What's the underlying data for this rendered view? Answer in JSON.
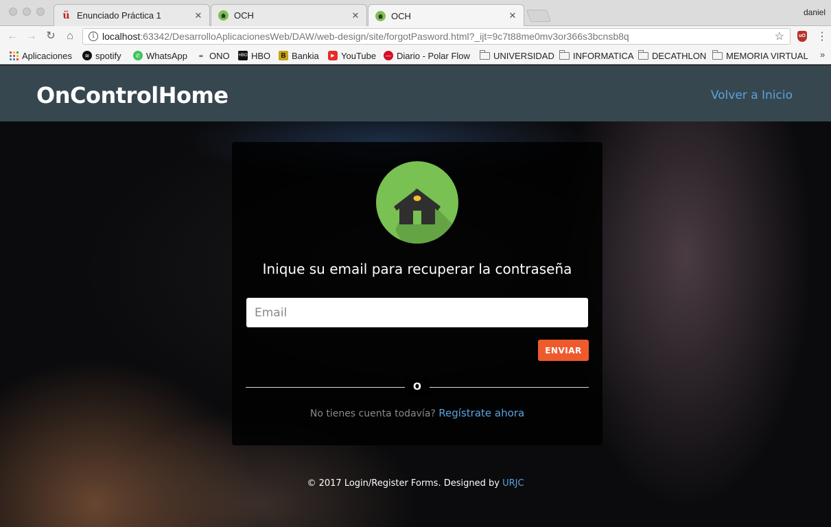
{
  "browser": {
    "tabs": [
      {
        "title": "Enunciado Práctica 1",
        "icon": "urjc-icon"
      },
      {
        "title": "OCH",
        "icon": "house-icon"
      },
      {
        "title": "OCH",
        "icon": "house-icon"
      }
    ],
    "user": "daniel",
    "url_host": "localhost",
    "url_path": ":63342/DesarrolloAplicacionesWeb/DAW/web-design/site/forgotPasword.html?_ijt=9c7t88me0mv3or366s3bcnsb8q",
    "ext_badge": "uO",
    "bookmarks": [
      {
        "label": "Aplicaciones",
        "icon": "apps-grid-icon"
      },
      {
        "label": "spotify",
        "icon": "spotify-icon"
      },
      {
        "label": "WhatsApp",
        "icon": "whatsapp-icon"
      },
      {
        "label": "ONO",
        "icon": "ono-icon"
      },
      {
        "label": "HBO",
        "icon": "hbo-icon"
      },
      {
        "label": "Bankia",
        "icon": "bankia-icon"
      },
      {
        "label": "YouTube",
        "icon": "youtube-icon"
      },
      {
        "label": "Diario - Polar Flow",
        "icon": "polar-icon"
      },
      {
        "label": "UNIVERSIDAD",
        "icon": "folder-icon"
      },
      {
        "label": "INFORMATICA",
        "icon": "folder-icon"
      },
      {
        "label": "DECATHLON",
        "icon": "folder-icon"
      },
      {
        "label": "MEMORIA VIRTUAL",
        "icon": "folder-icon"
      }
    ]
  },
  "header": {
    "brand": "OnControlHome",
    "back_link": "Volver a Inicio"
  },
  "form": {
    "prompt": "Inique su email para recuperar la contraseña",
    "email_placeholder": "Email",
    "send_label": "ENVIAR",
    "or_label": "O",
    "no_account": "No tienes cuenta todavía?",
    "register_link": "Regístrate ahora"
  },
  "footer": {
    "text": "© 2017 Login/Register Forms. Designed by",
    "link": "URJC"
  },
  "colors": {
    "navbar": "#37474f",
    "accent_link": "#59a3e0",
    "send_button": "#ee5a2c",
    "logo_green": "#79c152"
  }
}
